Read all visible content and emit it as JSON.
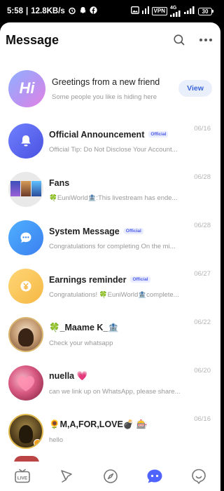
{
  "status_bar": {
    "time": "5:58",
    "speed": "12.8KB/s",
    "vpn": "VPN",
    "network": "4G",
    "battery": "30"
  },
  "header": {
    "title": "Message",
    "search_icon": "search-icon",
    "more_icon": "more-icon"
  },
  "greeting": {
    "avatar_text": "Hi",
    "title": "Greetings from a new friend",
    "subtitle": "Some people you like is hiding here",
    "button": "View"
  },
  "rows": [
    {
      "title": "Official Announcement",
      "badge": "Official",
      "subtitle": "Official Tip: Do Not Disclose Your Account...",
      "date": "06/16",
      "icon": "bell-icon",
      "color": "#5b63f0"
    },
    {
      "title": "Fans",
      "badge": "",
      "subtitle": "🍀EuniWorld🏦:This livestream has ende...",
      "date": "06/28",
      "icon": "fans-collage",
      "color": "#dcdcdc"
    },
    {
      "title": "System Message",
      "badge": "Official",
      "subtitle": "Congratulations for completing On the mi...",
      "date": "06/28",
      "icon": "chat-bubble-icon",
      "color": "#3f8ff0"
    },
    {
      "title": "Earnings reminder",
      "badge": "Official",
      "subtitle": "Congratulations! 🍀EuniWorld🏦complete...",
      "date": "06/27",
      "icon": "coin-icon",
      "color": "#f7c85a"
    },
    {
      "title": "🍀_Maame K_🏦",
      "badge": "",
      "subtitle": "Check your whatsapp",
      "date": "06/22",
      "icon": "user-avatar",
      "color": "#c9a27a"
    },
    {
      "title": "nuella 💗",
      "badge": "",
      "subtitle": "can we link up on WhatsApp, please share...",
      "date": "06/20",
      "icon": "user-avatar",
      "color": "#c8476f"
    },
    {
      "title": "🌻M,A,FOR,LOVE💣 🎰",
      "badge": "",
      "subtitle": "hello",
      "date": "06/16",
      "icon": "user-avatar",
      "color": "#5a4a2a"
    }
  ],
  "tabs": [
    {
      "icon": "live-tv-icon",
      "label": "LIVE"
    },
    {
      "icon": "sword-icon"
    },
    {
      "icon": "compass-icon"
    },
    {
      "icon": "message-bubble-icon"
    },
    {
      "icon": "profile-icon"
    }
  ],
  "colors": {
    "accent": "#3a63d8",
    "badge_bg": "#eaedff",
    "active_tab": "#4f63ff",
    "greet_gradient_start": "#8fb0ff",
    "greet_gradient_end": "#d77fe7"
  }
}
